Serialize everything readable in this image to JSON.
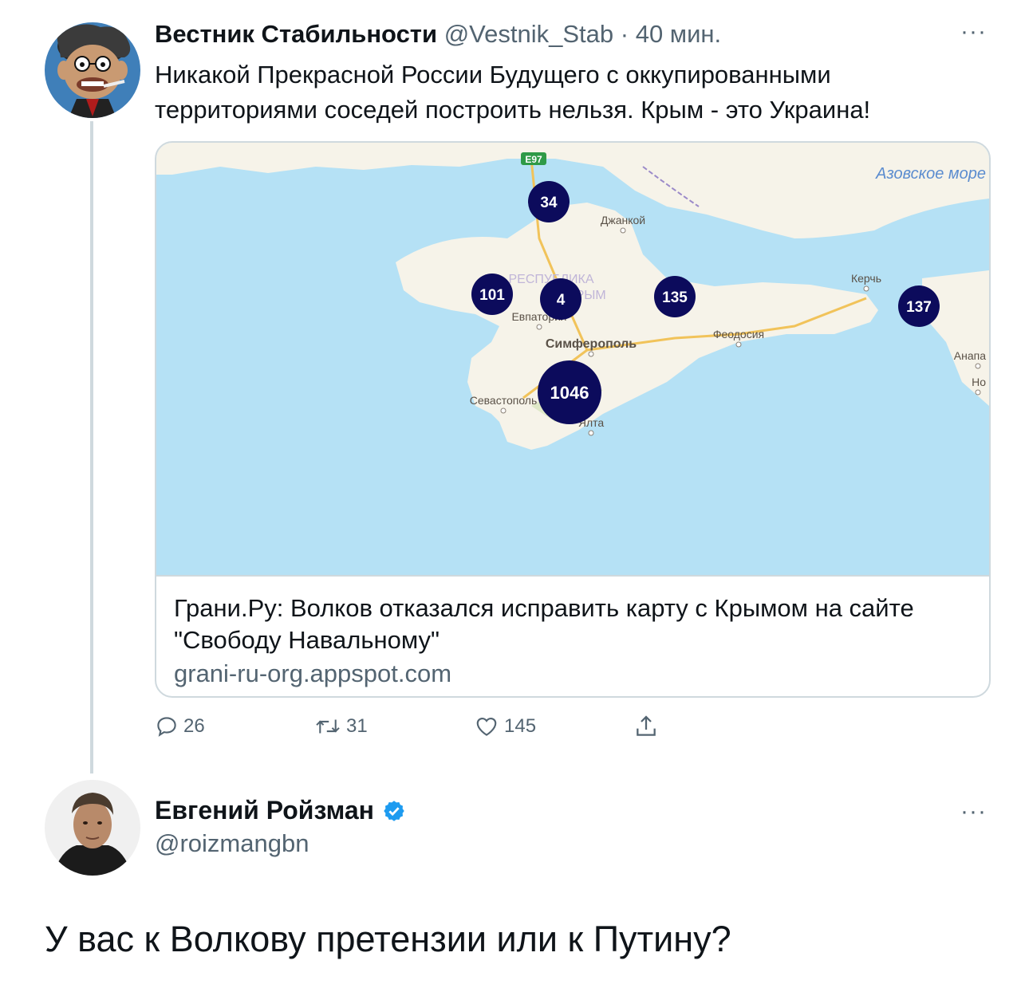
{
  "tweet": {
    "author_name": "Вестник Стабильности",
    "handle": "@Vestnik_Stab",
    "separator": "·",
    "time": "40 мин.",
    "more": "···",
    "text": "Никакой Прекрасной России Будущего с оккупированными территориями соседей построить нельзя. Крым - это Украина!",
    "card": {
      "title": "Грани.Ру: Волков отказался исправить карту с Крымом на сайте \"Свободу Навальному\"",
      "domain": "grani-ru-org.appspot.com",
      "map": {
        "sea_label": "Азовское море",
        "road_label": "E97",
        "region_label_1": "РЕСПУБЛИКА",
        "region_label_2": "КРЫМ",
        "cities": [
          "Джанкой",
          "Евпатория",
          "Симферополь",
          "Феодосия",
          "Керчь",
          "Анапа",
          "Ho",
          "Севастополь",
          "Ялта"
        ],
        "clusters": [
          "34",
          "101",
          "4",
          "135",
          "137",
          "1046"
        ]
      }
    },
    "actions": {
      "replies": "26",
      "retweets": "31",
      "likes": "145"
    }
  },
  "reply": {
    "author_name": "Евгений Ройзман",
    "handle": "@roizmangbn",
    "more": "···",
    "text": "У вас к Волкову претензии или к Путину?"
  },
  "colors": {
    "text": "#0f1419",
    "muted": "#536471",
    "border": "#cfd9de",
    "verified": "#1d9bf0",
    "sea": "#b5e1f5",
    "land": "#f6f3e9",
    "cluster": "#0c0b5c"
  }
}
